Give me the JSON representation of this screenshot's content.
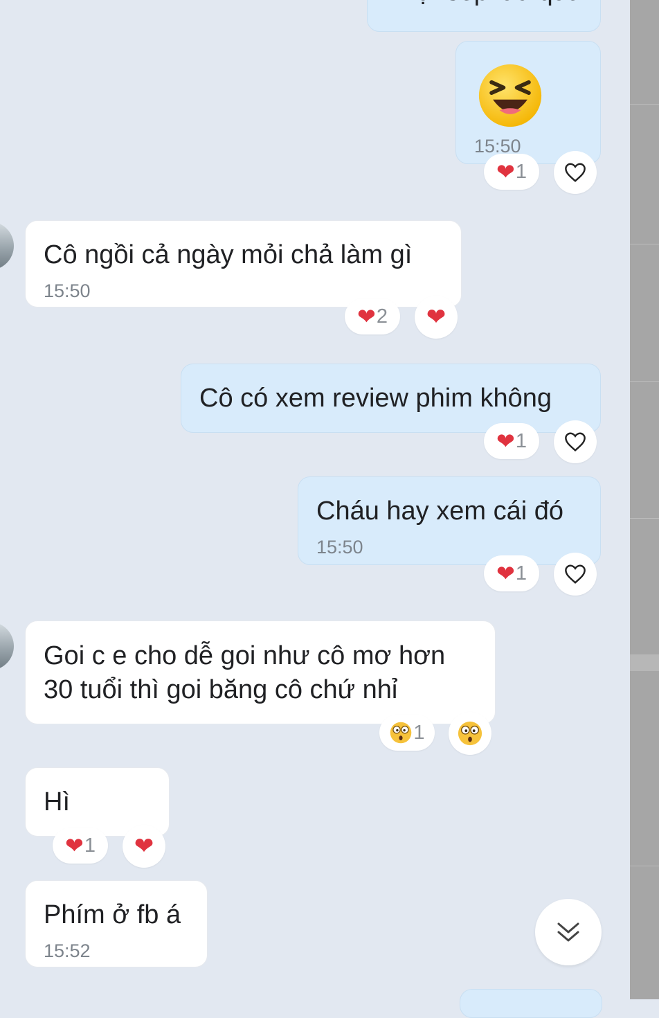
{
  "messages": [
    {
      "id": "m1",
      "direction": "out",
      "text": "Đợi sếp lâu quá"
    },
    {
      "id": "m2",
      "direction": "out",
      "sticker": "laughing-emoji",
      "time": "15:50",
      "reaction": {
        "emoji": "heart",
        "count": "1"
      }
    },
    {
      "id": "m3",
      "direction": "in",
      "text": "Cô ngồi cả ngày mỏi chả làm gì",
      "time": "15:50",
      "reaction": {
        "emoji": "heart",
        "count": "2"
      }
    },
    {
      "id": "m4",
      "direction": "out",
      "text": "Cô có xem review phim không",
      "reaction": {
        "emoji": "heart",
        "count": "1"
      }
    },
    {
      "id": "m5",
      "direction": "out",
      "text": "Cháu hay xem cái đó",
      "time": "15:50",
      "reaction": {
        "emoji": "heart",
        "count": "1"
      }
    },
    {
      "id": "m6",
      "direction": "in",
      "lines": [
        "Goi c e cho dễ goi như cô mơ hơn",
        "30 tuổi thì goi băng cô chứ nhỉ"
      ],
      "reaction": {
        "emoji": "surprised",
        "count": "1"
      }
    },
    {
      "id": "m7",
      "direction": "in",
      "text": "Hì",
      "reaction": {
        "emoji": "heart",
        "count": "1"
      }
    },
    {
      "id": "m8",
      "direction": "in",
      "text": "Phím ở fb á",
      "time": "15:52"
    }
  ],
  "colors": {
    "background": "#e2e8f1",
    "outgoing": "#d8ebfb",
    "incoming": "#ffffff",
    "heart": "#e0333f"
  }
}
